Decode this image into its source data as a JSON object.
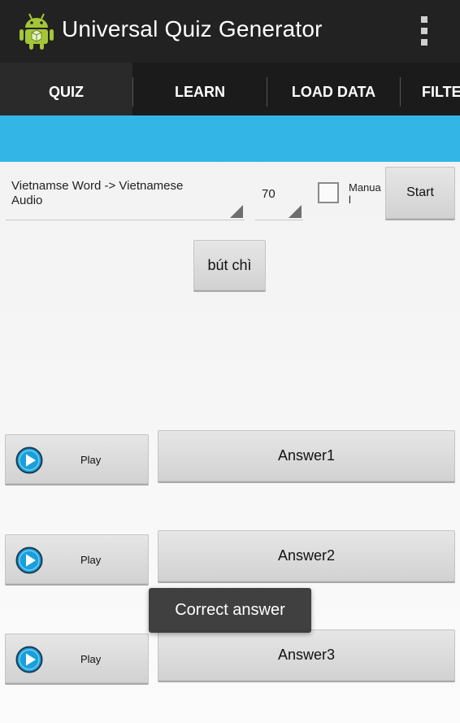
{
  "app": {
    "title": "Universal Quiz Generator",
    "icon": "android-robot-icon"
  },
  "tabs": [
    {
      "label": "QUIZ",
      "selected": true
    },
    {
      "label": "LEARN",
      "selected": false
    },
    {
      "label": "LOAD DATA",
      "selected": false
    },
    {
      "label": "FILTE",
      "selected": false
    }
  ],
  "controls": {
    "mode": "Vietnamse Word -> Vietnamese Audio",
    "count": "70",
    "manual_label": "Manual",
    "manual_checked": false,
    "start_label": "Start"
  },
  "question": {
    "word": "bút chì"
  },
  "answers": [
    {
      "play_label": "Play",
      "answer_label": "Answer1"
    },
    {
      "play_label": "Play",
      "answer_label": "Answer2"
    },
    {
      "play_label": "Play",
      "answer_label": "Answer3"
    }
  ],
  "toast": {
    "text": "Correct answer"
  },
  "colors": {
    "accent": "#33b5e5",
    "actionbar": "#222222",
    "tabbar": "#1b1b1b",
    "android_green": "#a4c639"
  }
}
